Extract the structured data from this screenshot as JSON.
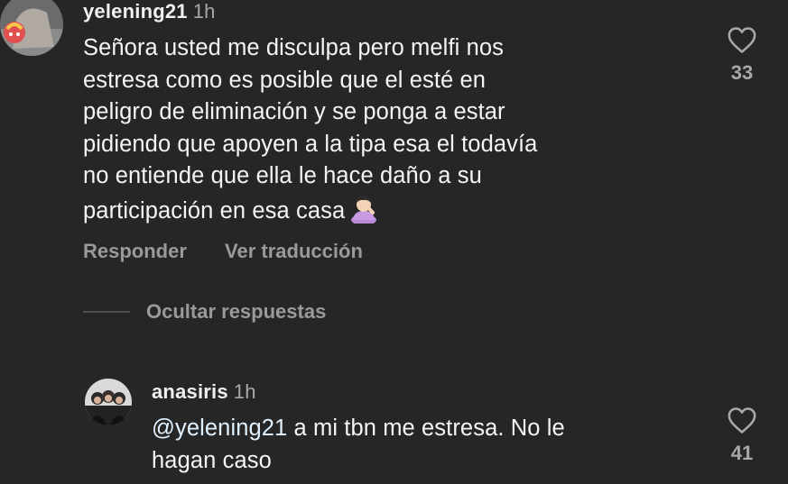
{
  "comments": [
    {
      "username": "yelening21",
      "time": "1h",
      "text_lines": [
        "Señora usted me disculpa pero melfi nos",
        "estresa como es posible que el esté en",
        "peligro de eliminación y se ponga a estar",
        "pidiendo que apoyen a la tipa esa el todavía",
        "no entiende que ella le hace daño a su",
        "participación en esa casa"
      ],
      "emoji": "person-facepalming-icon",
      "like_count": "33",
      "reply_label": "Responder",
      "translate_label": "Ver traducción"
    }
  ],
  "hide_replies_label": "Ocultar respuestas",
  "reply": {
    "username": "anasiris",
    "time": "1h",
    "mention": "@yelening21",
    "text_line1": " a mi tbn me estresa. No le",
    "text_line2": "hagan caso",
    "like_count": "41"
  },
  "colors": {
    "background": "#262626",
    "text": "#f5f5f5",
    "muted": "#9a9a9a",
    "mention": "#e0f1ff"
  }
}
